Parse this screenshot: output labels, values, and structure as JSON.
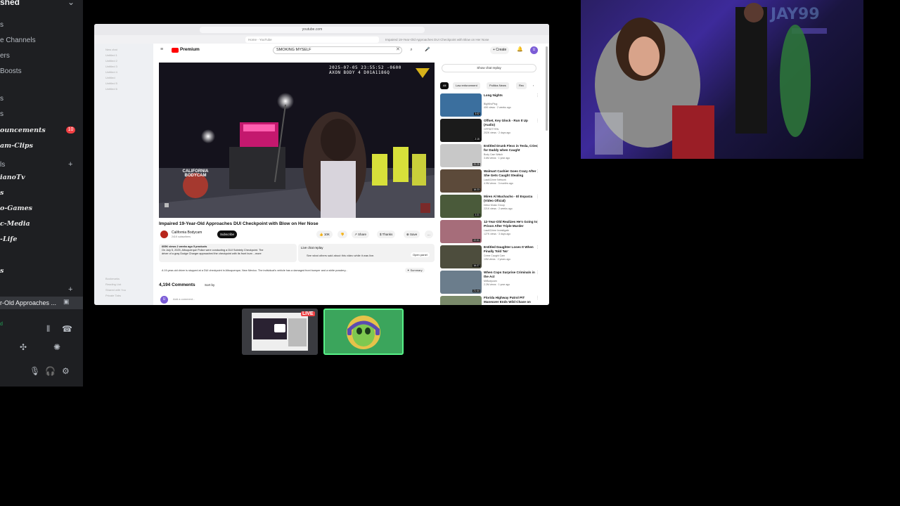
{
  "discord": {
    "server_title": "shed",
    "items": [
      {
        "label": "s",
        "style": "plain"
      },
      {
        "label": "e Channels",
        "style": "plain"
      },
      {
        "label": "ers",
        "style": "plain"
      },
      {
        "label": "Boosts",
        "style": "plain"
      },
      {
        "label": "s",
        "style": "plain"
      },
      {
        "label": "s",
        "style": "plain"
      },
      {
        "label": "ouncements",
        "style": "fancy"
      },
      {
        "label": "am-Clips",
        "style": "fancy"
      },
      {
        "label": "ls",
        "style": "plain"
      },
      {
        "label": "ianoTv",
        "style": "fancy"
      },
      {
        "label": "s",
        "style": "fancy"
      },
      {
        "label": "o-Games",
        "style": "fancy"
      },
      {
        "label": "c-Media",
        "style": "fancy"
      },
      {
        "label": "-Life",
        "style": "fancy"
      },
      {
        "label": "s",
        "style": "fancy"
      }
    ],
    "badge": "10",
    "voice_stream_label": "r-Old Approaches ...",
    "connection_status": "d"
  },
  "browser": {
    "url": "youtube.com",
    "tabs": [
      "Home - YouTube",
      "Impaired 19-Year-Old Approaches DUI Checkpoint with Blow on Her Nose"
    ],
    "side_panel_items": [
      "New chat",
      "Untitled 1",
      "Untitled 2",
      "Untitled 3",
      "Untitled 4",
      "Untitled",
      "Untitled 5",
      "Untitled 6",
      "Bookmarks",
      "Reading List",
      "Shared with You",
      "Private Tabs"
    ]
  },
  "youtube": {
    "logo_text": "Premium",
    "search_value": "SMOKING MYSELF",
    "create_label": "+ Create",
    "avatar_letter": "U",
    "camera_timestamp": "2025-07-05 23:55:52 -0600",
    "camera_id": "AXON BODY 4 D01A1186Q",
    "camera_badge": "CALIFORNIA BODYCAM",
    "video_title": "Impaired 19-Year-Old Approaches DUI Checkpoint with Blow on Her Nose",
    "channel_name": "California Bodycam",
    "channel_subs": "241K subscribers",
    "subscribe_label": "Subscribe",
    "actions": [
      "👍 10K",
      "👎",
      "↗ Share",
      "$ Thanks",
      "⊕ Save",
      "..."
    ],
    "description_lines": [
      "605K views  2 weeks ago  5 products",
      "On July 5, 2025, Albuquerque Police were conducting a DUI Sobriety Checkpoint. The",
      "driver of a gray Dodge Charger approached the checkpoint with its front bum ...more"
    ],
    "live_chat_title": "Live chat replay",
    "live_chat_sub": "See what others said about this video while it was live.",
    "open_panel_label": "Open panel",
    "summary_line": "A 19-year-old driver is stopped at a DUI checkpoint in Albuquerque, New Mexico. The individual's vehicle has a damaged front bumper and a white powdery...",
    "summary_label": "✦ Summary",
    "comments_count": "4,194 Comments",
    "sort_label": "Sort by",
    "add_comment": "Add a comment...",
    "show_chat_replay": "Show chat replay",
    "chips": [
      "All",
      "Law enforcement",
      "Politics News",
      "Rec"
    ],
    "recommendations": [
      {
        "title": "Long Nights",
        "channel": "BigWhoPlug",
        "meta": "40K views · 2 weeks ago",
        "duration": "3:02",
        "color": "#3b6f9e"
      },
      {
        "title": "Offset, Key Glock - Run It Up (Audio)",
        "channel": "OFFSETYRN",
        "meta": "202K views · 2 days ago",
        "duration": "2:15",
        "color": "#1b1b1b"
      },
      {
        "title": "Entitled Drunk Flexs in Tesla, Cries for Daddy when Caught",
        "channel": "Body Cam Watch",
        "meta": "3.6M views · 1 year ago",
        "duration": "20:25",
        "color": "#c8c8c8"
      },
      {
        "title": "Walmart Cashier Goes Crazy After She Gets Caught Stealing",
        "channel": "Law&Crime Network",
        "meta": "4.9M views · 3 months ago",
        "duration": "16:23",
        "color": "#5c4a3a"
      },
      {
        "title": "Miren Al Muchacho - El Esparza (Video Oficial)",
        "channel": "Delux Music Group",
        "meta": "221K views · 2 weeks ago",
        "duration": "2:21",
        "color": "#4a5a3a"
      },
      {
        "title": "12-Year-Old Realizes He's Going to Prison After Triple Murder",
        "channel": "Law&Crime Investigate",
        "meta": "127K views · 3 days ago",
        "duration": "22:01",
        "color": "#a66d7a"
      },
      {
        "title": "Entitled Daughter Loses It When Finally Told 'No'",
        "channel": "Crime Caught Cam",
        "meta": "10M views · 2 years ago",
        "duration": "16:27",
        "color": "#4d4d3d"
      },
      {
        "title": "When Cops Surprise Criminals in the Act",
        "channel": "MrBodycam",
        "meta": "2.2M views · 1 year ago",
        "duration": "21:44",
        "color": "#6b7d8c"
      },
      {
        "title": "Florida Highway Patrol PIT Maneuver Ends Wild Chase on",
        "channel": "",
        "meta": "",
        "duration": "",
        "color": "#7a8a6a"
      }
    ]
  },
  "stream_tiles": {
    "live_badge": "LIVE"
  },
  "webcam": {
    "wall_text": "JAY99"
  }
}
